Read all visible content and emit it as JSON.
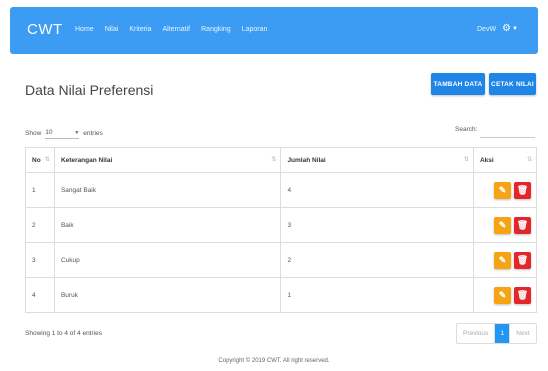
{
  "navbar": {
    "brand": "CWT",
    "links": [
      "Home",
      "Nilai",
      "Kriteria",
      "Alternatif",
      "Rangking",
      "Laporan"
    ],
    "user": "DevW"
  },
  "page": {
    "title": "Data Nilai Preferensi",
    "add_label": "TAMBAH DATA",
    "print_label": "CETAK NILAI"
  },
  "table_controls": {
    "show_label": "Show",
    "show_value": "10",
    "entries_label": "entries",
    "search_label": "Search:"
  },
  "table": {
    "headers": [
      "No",
      "Keterangan Nilai",
      "Jumlah Nilai",
      "Aksi"
    ],
    "rows": [
      {
        "no": "1",
        "keterangan": "Sangat Baik",
        "jumlah": "4"
      },
      {
        "no": "2",
        "keterangan": "Baik",
        "jumlah": "3"
      },
      {
        "no": "3",
        "keterangan": "Cukup",
        "jumlah": "2"
      },
      {
        "no": "4",
        "keterangan": "Buruk",
        "jumlah": "1"
      }
    ]
  },
  "pagination": {
    "info": "Showing 1 to 4 of 4 entries",
    "previous": "Previous",
    "current": "1",
    "next": "Next"
  },
  "footer": {
    "copyright": "Copyright © 2019 CWT. All right reserved."
  },
  "colors": {
    "navbar": "#3c9cf3",
    "primary_button": "#1f86e8",
    "edit_button": "#f6a314",
    "delete_button": "#e3262b",
    "active_page": "#2196f3"
  },
  "icons": {
    "settings": "gear-icon",
    "edit": "pencil-icon",
    "delete": "trash-icon",
    "sort": "sort-icon"
  }
}
